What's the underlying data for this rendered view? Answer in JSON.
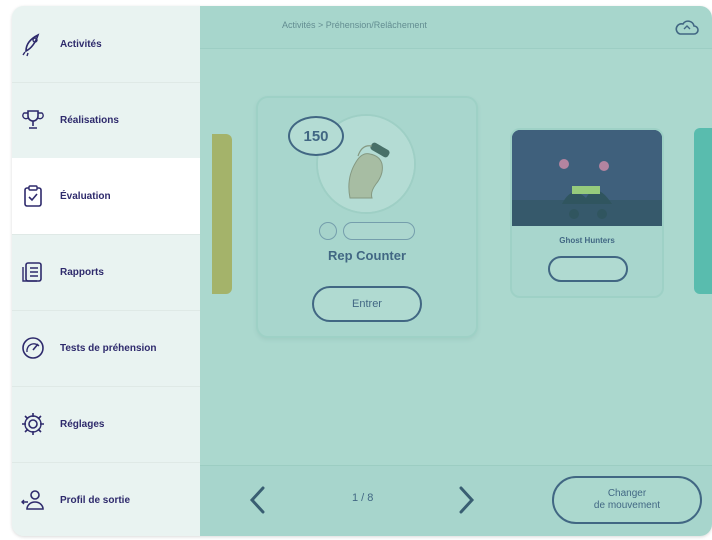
{
  "sidebar": {
    "items": [
      {
        "label": "Activités",
        "icon": "rocket-icon"
      },
      {
        "label": "Réalisations",
        "icon": "trophy-icon"
      },
      {
        "label": "Évaluation",
        "icon": "clipboard-check-icon"
      },
      {
        "label": "Rapports",
        "icon": "report-icon"
      },
      {
        "label": "Tests de préhension",
        "icon": "gauge-icon"
      },
      {
        "label": "Réglages",
        "icon": "gear-icon"
      },
      {
        "label": "Profil de sortie",
        "icon": "user-exit-icon"
      }
    ],
    "active_index": 2
  },
  "topbar": {
    "breadcrumb": "Activités > Préhension/Relâchement",
    "cloud_icon": "cloud-sync-icon"
  },
  "main_card": {
    "count": "150",
    "title": "Rep Counter",
    "enter_label": "Entrer"
  },
  "side_card": {
    "title": "Ghost Hunters"
  },
  "bottombar": {
    "page": "1 / 8",
    "change_label": "Changer\nde mouvement",
    "prev_icon": "chevron-left-icon",
    "next_icon": "chevron-right-icon"
  },
  "colors": {
    "primary": "#2e2a6c",
    "overlay": "#58b2a0",
    "background": "#eef7f4"
  }
}
